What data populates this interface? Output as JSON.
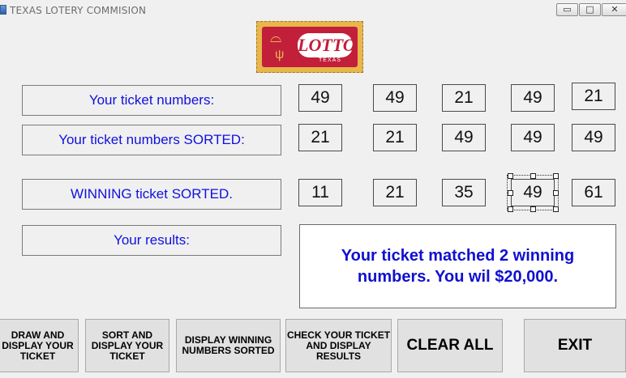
{
  "window": {
    "title": "TEXAS LOTERY COMMISION",
    "controls": {
      "minimize": "▭",
      "maximize": "□",
      "close": "✕"
    }
  },
  "logo": {
    "word": "LOTTO",
    "sub": "TEXAS",
    "colors": {
      "background": "#e8b64a",
      "panel": "#c21f3a"
    }
  },
  "labels": {
    "ticket": "Your ticket numbers:",
    "sorted": "Your ticket numbers SORTED:",
    "winning": "WINNING ticket SORTED.",
    "results": "Your results:"
  },
  "numbers": {
    "ticket": [
      "49",
      "49",
      "21",
      "49",
      "21"
    ],
    "sorted": [
      "21",
      "21",
      "49",
      "49",
      "49"
    ],
    "winning": [
      "11",
      "21",
      "35",
      "49",
      "61"
    ]
  },
  "results_text": "Your ticket matched 2 winning numbers. You wil $20,000.",
  "buttons": {
    "draw": "DRAW AND DISPLAY YOUR TICKET",
    "sort": "SORT AND DISPLAY YOUR TICKET",
    "display_winning": "DISPLAY WINNING NUMBERS SORTED",
    "check": "CHECK YOUR TICKET AND DISPLAY RESULTS",
    "clear": "CLEAR ALL",
    "exit": "EXIT"
  },
  "colors": {
    "label_text": "#1010e0",
    "result_text": "#1010d0",
    "window_bg": "#f0f0f0"
  }
}
